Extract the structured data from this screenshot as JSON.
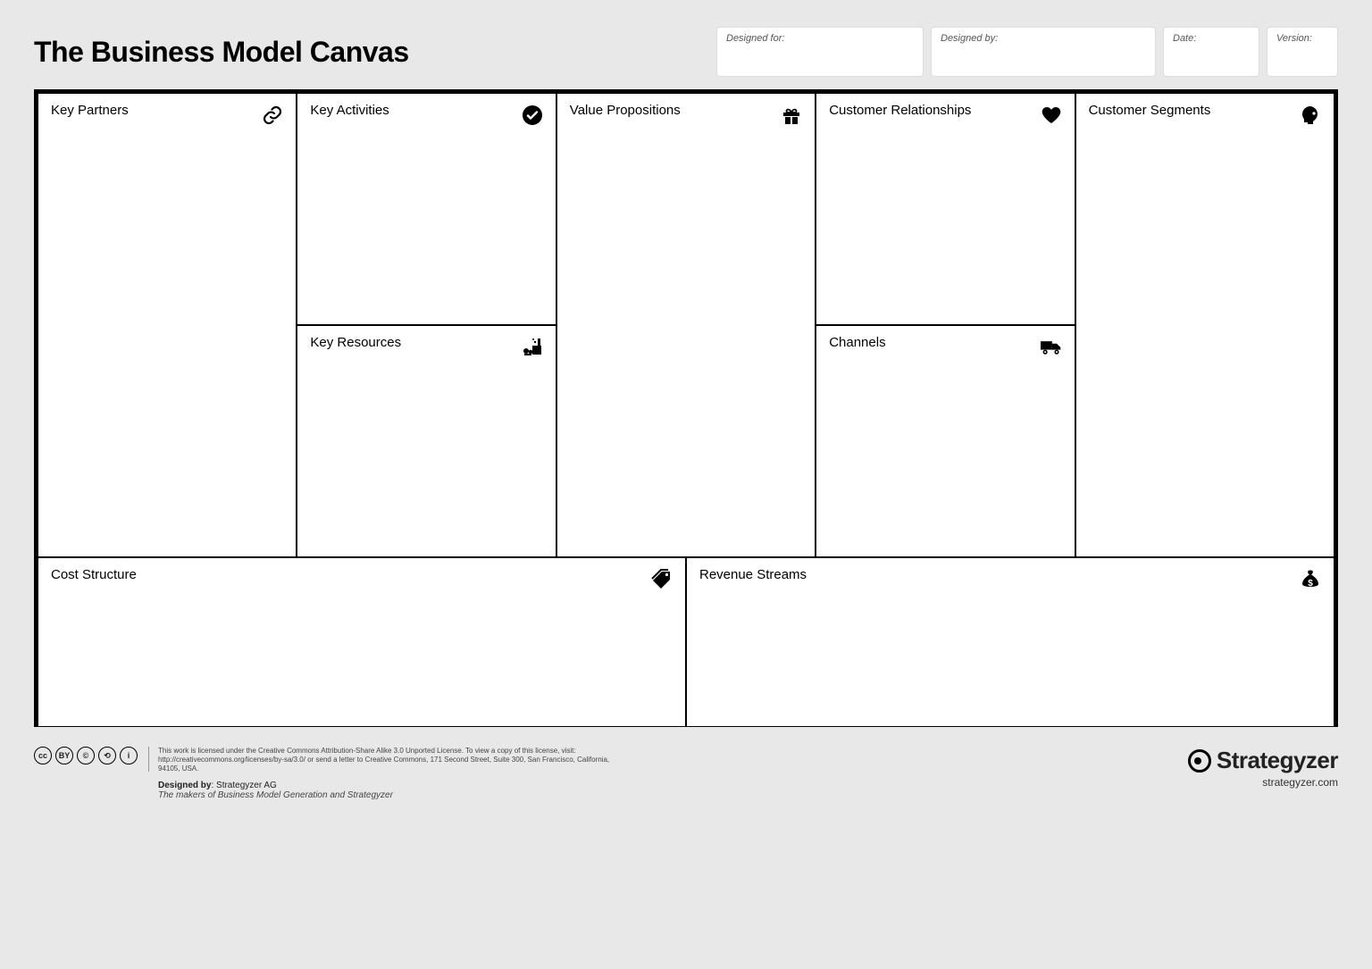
{
  "title": "The Business Model Canvas",
  "meta": {
    "designed_for_label": "Designed for:",
    "designed_by_label": "Designed by:",
    "date_label": "Date:",
    "version_label": "Version:"
  },
  "cells": {
    "key_partners": "Key Partners",
    "key_activities": "Key Activities",
    "key_resources": "Key Resources",
    "value_propositions": "Value Propositions",
    "customer_relationships": "Customer Relationships",
    "channels": "Channels",
    "customer_segments": "Customer Segments",
    "cost_structure": "Cost Structure",
    "revenue_streams": "Revenue Streams"
  },
  "footer": {
    "license_line1": "This work is licensed under the Creative Commons Attribution-Share Alike 3.0 Unported License. To view a copy of this license, visit:",
    "license_line2": "http://creativecommons.org/licenses/by-sa/3.0/ or send a letter to Creative Commons, 171 Second Street, Suite 300, San Francisco, California, 94105, USA.",
    "designed_by_label": "Designed by",
    "designed_by_value": ": Strategyzer AG",
    "makers_line": "The makers of Business Model Generation and Strategyzer",
    "brand_name": "Strategyzer",
    "brand_url": "strategyzer.com",
    "cc_badges": [
      "cc",
      "BY",
      "©",
      "⟲",
      "i"
    ]
  }
}
